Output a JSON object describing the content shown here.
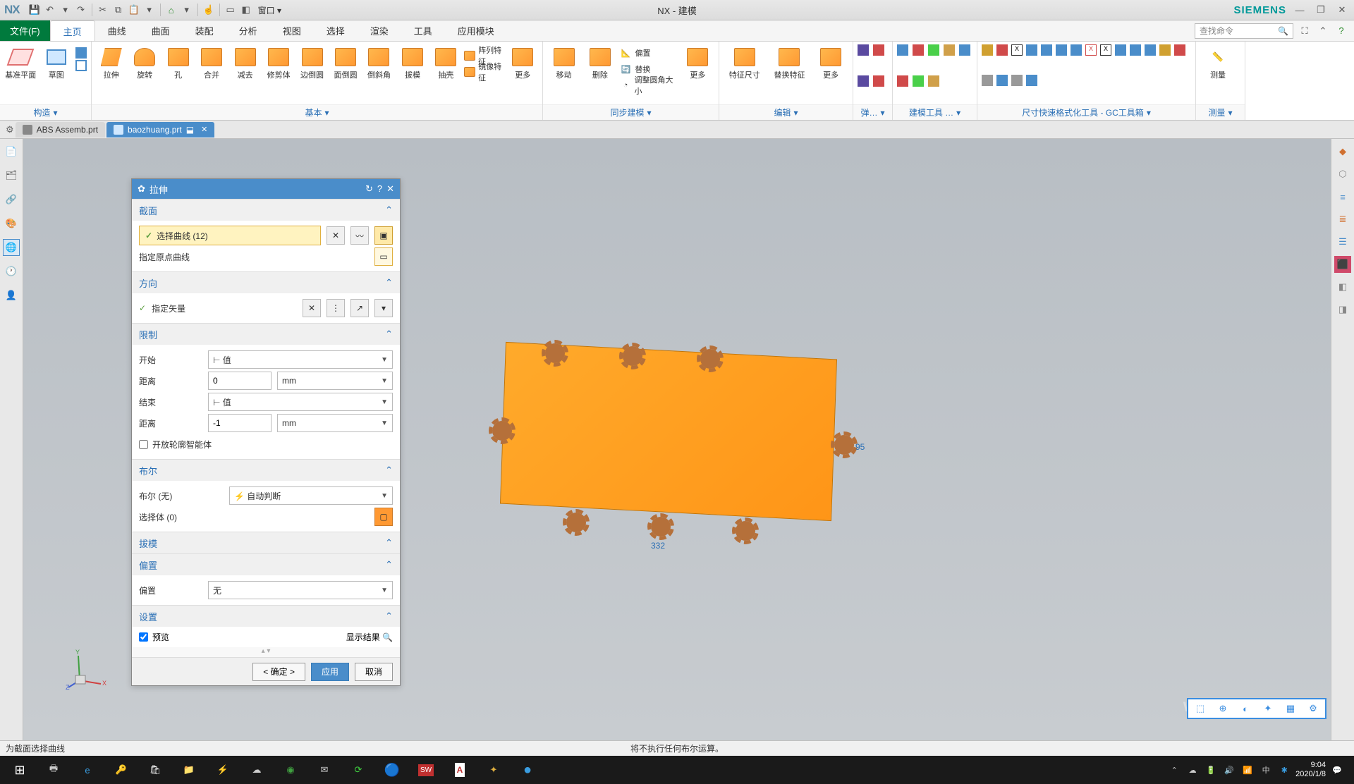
{
  "app": {
    "logo": "NX",
    "title": "NX - 建模",
    "brand": "SIEMENS",
    "window_menu": "窗口 ▾"
  },
  "search": {
    "placeholder": "查找命令",
    "icon": "🔍"
  },
  "menu": {
    "file": "文件(F)",
    "tabs": [
      "主页",
      "曲线",
      "曲面",
      "装配",
      "分析",
      "视图",
      "选择",
      "渲染",
      "工具",
      "应用模块"
    ],
    "active": 0
  },
  "ribbon": {
    "groups": [
      {
        "label": "构造",
        "items": [
          {
            "l": "基准平面"
          },
          {
            "l": "草图"
          }
        ]
      },
      {
        "label": "基本",
        "items": [
          {
            "l": "拉伸"
          },
          {
            "l": "旋转"
          },
          {
            "l": "孔"
          },
          {
            "l": "合并"
          },
          {
            "l": "减去"
          },
          {
            "l": "修剪体"
          },
          {
            "l": "边倒圆"
          },
          {
            "l": "面倒圆"
          },
          {
            "l": "倒斜角"
          },
          {
            "l": "拔模"
          },
          {
            "l": "抽壳"
          }
        ],
        "side": [
          {
            "l": "阵列特征"
          },
          {
            "l": "镜像特征"
          }
        ],
        "more": "更多"
      },
      {
        "label": "同步建模",
        "items": [
          {
            "l": "移动"
          },
          {
            "l": "删除"
          }
        ],
        "side": [
          {
            "l": "偏置"
          },
          {
            "l": "替换"
          },
          {
            "l": "调整圆角大小"
          }
        ],
        "more": "更多"
      },
      {
        "label": "编辑",
        "items": [
          {
            "l": "特征尺寸"
          },
          {
            "l": "替换特征"
          }
        ],
        "more": "更多"
      },
      {
        "label": "弹…"
      },
      {
        "label": "建模工具 …"
      },
      {
        "label": "尺寸快速格式化工具 - GC工具箱"
      },
      {
        "label": "测量",
        "items": [
          {
            "l": "测量"
          }
        ]
      }
    ]
  },
  "part_tabs": [
    {
      "name": "ABS Assemb.prt",
      "active": false
    },
    {
      "name": "baozhuang.prt",
      "active": true
    }
  ],
  "dialog": {
    "title": "拉伸",
    "sections": {
      "section": {
        "h": "截面",
        "select_curve": "选择曲线 (12)",
        "origin_curve": "指定原点曲线"
      },
      "direction": {
        "h": "方向",
        "vector": "指定矢量"
      },
      "limits": {
        "h": "限制",
        "start": "开始",
        "start_type": "值",
        "dist": "距离",
        "start_val": "0",
        "end": "结束",
        "end_type": "值",
        "end_val": "-1",
        "unit": "mm",
        "open_profile": "开放轮廓智能体"
      },
      "bool": {
        "h": "布尔",
        "bool_label": "布尔 (无)",
        "bool_val": "自动判断",
        "select_body": "选择体 (0)"
      },
      "draft": {
        "h": "拔模"
      },
      "offset": {
        "h": "偏置",
        "label": "偏置",
        "val": "无"
      },
      "settings": {
        "h": "设置"
      },
      "preview": "预览",
      "show_result": "显示结果"
    },
    "buttons": {
      "ok": "< 确定 >",
      "apply": "应用",
      "cancel": "取消"
    }
  },
  "model": {
    "dim_h": "332",
    "dim_v": "95"
  },
  "status": {
    "left": "为截面选择曲线",
    "center": "将不执行任何布尔运算。"
  },
  "watermark": "www.3dsw.cc",
  "taskbar": {
    "time": "9:04",
    "date": "2020/1/8",
    "ime": "中"
  }
}
